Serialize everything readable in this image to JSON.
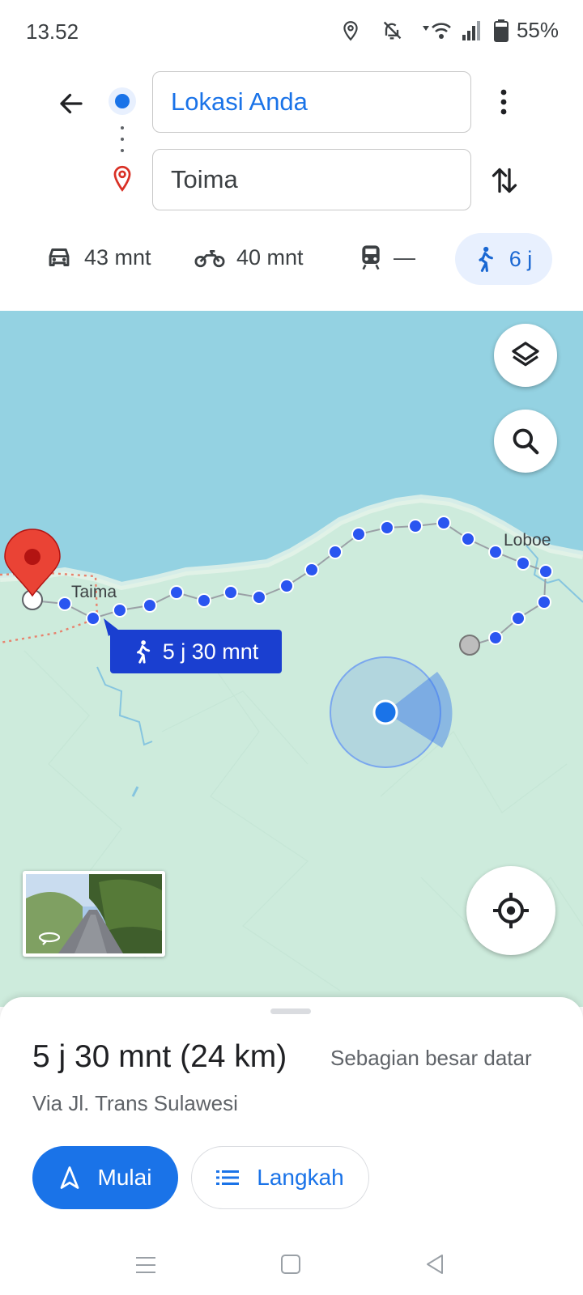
{
  "status_bar": {
    "time": "13.52",
    "battery": "55%",
    "icons": [
      "location-icon",
      "notifications-off-icon",
      "wifi-icon",
      "signal-icon",
      "battery-icon"
    ]
  },
  "header": {
    "origin": "Lokasi Anda",
    "destination": "Toima",
    "modes": {
      "drive": "43 mnt",
      "motorcycle": "40 mnt",
      "transit": "—",
      "walk": "6 j"
    }
  },
  "map": {
    "labels": {
      "taima": "Taima",
      "loboe": "Loboe"
    },
    "route_callout": "5 j 30 mnt"
  },
  "sheet": {
    "duration": "5 j 30 mnt (24 km)",
    "terrain": "Sebagian besar datar",
    "via": "Via Jl. Trans Sulawesi",
    "start_label": "Mulai",
    "steps_label": "Langkah"
  },
  "colors": {
    "accent": "#1a73e8",
    "route": "#2a55f0",
    "water": "#94d2e2",
    "land": "#cdebdc"
  }
}
